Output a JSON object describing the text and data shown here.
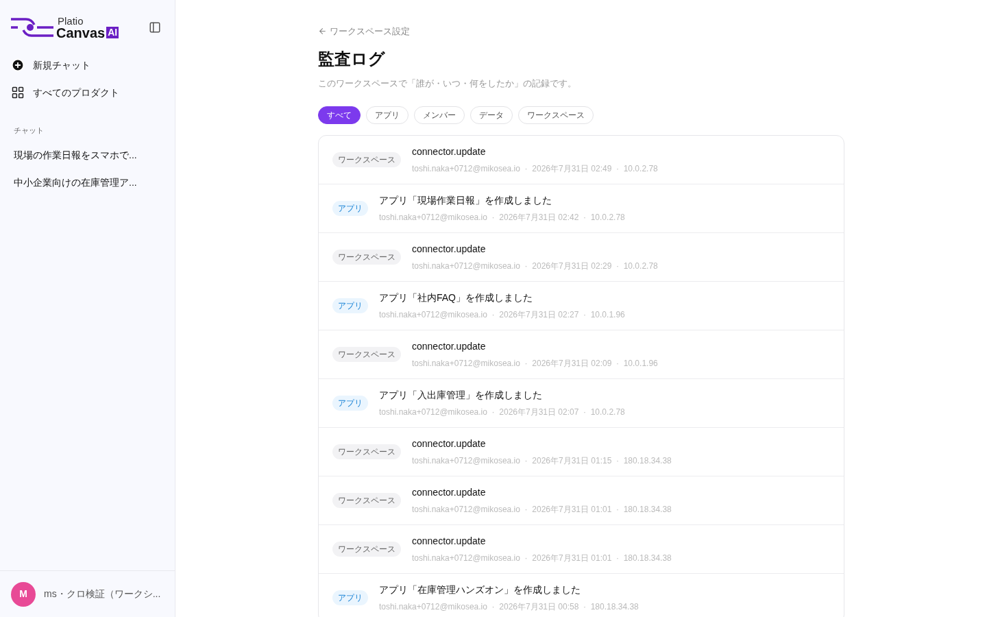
{
  "sidebar": {
    "logo": {
      "line1": "Platio",
      "line2": "Canvas",
      "badge": "AI"
    },
    "nav": [
      {
        "kind": "new",
        "label": "新規チャット"
      },
      {
        "kind": "grid",
        "label": "すべてのプロダクト"
      }
    ],
    "section_label": "チャット",
    "chats": [
      "現場の作業日報をスマホで...",
      "中小企業向けの在庫管理ア..."
    ],
    "user": {
      "initial": "M",
      "name": "ms・クロ検証（ワークシ..."
    }
  },
  "back_link": "ワークスペース設定",
  "title": "監査ログ",
  "subtitle": "このワークスペースで「誰が・いつ・何をしたか」の記録です。",
  "filters": [
    {
      "label": "すべて",
      "selected": true
    },
    {
      "label": "アプリ",
      "selected": false
    },
    {
      "label": "メンバー",
      "selected": false
    },
    {
      "label": "データ",
      "selected": false
    },
    {
      "label": "ワークスペース",
      "selected": false
    }
  ],
  "log": [
    {
      "kind": "workspace",
      "tag": "ワークスペース",
      "action": "connector.update",
      "meta": "toshi.naka+0712@mikosea.io  ·  2026年7月31日 02:49  ·  10.0.2.78"
    },
    {
      "kind": "app",
      "tag": "アプリ",
      "action": "アプリ「現場作業日報」を作成しました",
      "meta": "toshi.naka+0712@mikosea.io  ·  2026年7月31日 02:42  ·  10.0.2.78"
    },
    {
      "kind": "workspace",
      "tag": "ワークスペース",
      "action": "connector.update",
      "meta": "toshi.naka+0712@mikosea.io  ·  2026年7月31日 02:29  ·  10.0.2.78"
    },
    {
      "kind": "app",
      "tag": "アプリ",
      "action": "アプリ「社内FAQ」を作成しました",
      "meta": "toshi.naka+0712@mikosea.io  ·  2026年7月31日 02:27  ·  10.0.1.96"
    },
    {
      "kind": "workspace",
      "tag": "ワークスペース",
      "action": "connector.update",
      "meta": "toshi.naka+0712@mikosea.io  ·  2026年7月31日 02:09  ·  10.0.1.96"
    },
    {
      "kind": "app",
      "tag": "アプリ",
      "action": "アプリ「入出庫管理」を作成しました",
      "meta": "toshi.naka+0712@mikosea.io  ·  2026年7月31日 02:07  ·  10.0.2.78"
    },
    {
      "kind": "workspace",
      "tag": "ワークスペース",
      "action": "connector.update",
      "meta": "toshi.naka+0712@mikosea.io  ·  2026年7月31日 01:15  ·  180.18.34.38"
    },
    {
      "kind": "workspace",
      "tag": "ワークスペース",
      "action": "connector.update",
      "meta": "toshi.naka+0712@mikosea.io  ·  2026年7月31日 01:01  ·  180.18.34.38"
    },
    {
      "kind": "workspace",
      "tag": "ワークスペース",
      "action": "connector.update",
      "meta": "toshi.naka+0712@mikosea.io  ·  2026年7月31日 01:01  ·  180.18.34.38"
    },
    {
      "kind": "app",
      "tag": "アプリ",
      "action": "アプリ「在庫管理ハンズオン」を作成しました",
      "meta": "toshi.naka+0712@mikosea.io  ·  2026年7月31日 00:58  ·  180.18.34.38"
    }
  ]
}
